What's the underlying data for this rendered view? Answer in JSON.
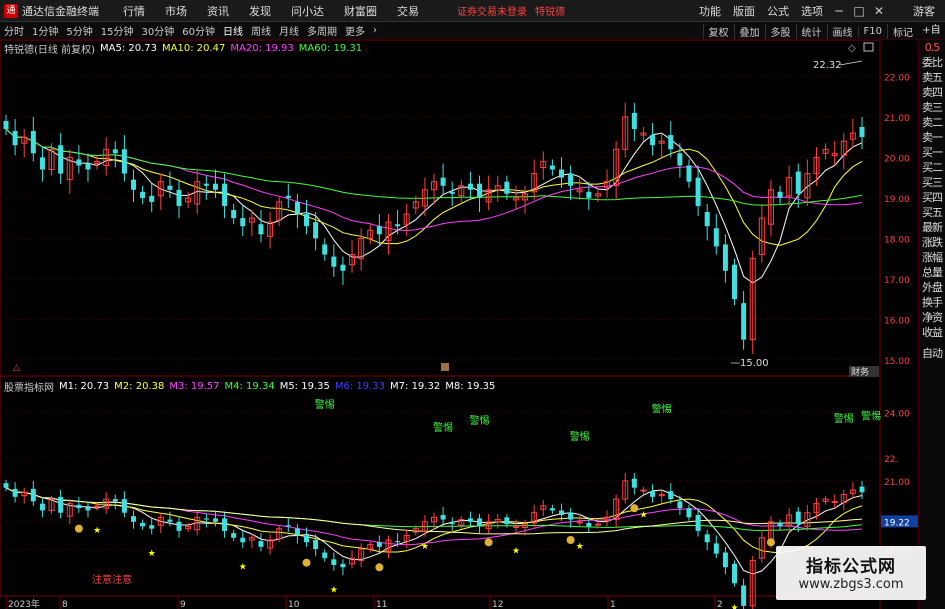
{
  "app": {
    "name": "通达信金融终端",
    "logo_text": "通",
    "menu": [
      "行情",
      "市场",
      "资讯",
      "发现",
      "问小达",
      "财富圈",
      "交易"
    ],
    "notice": "证券交易未登录",
    "stock_name": "特锐德",
    "tools": [
      "功能",
      "版面",
      "公式",
      "选项"
    ],
    "guest": "游客",
    "window_buttons": [
      "─",
      "□",
      "✕"
    ]
  },
  "toolbar": {
    "periods": [
      "分时",
      "1分钟",
      "5分钟",
      "15分钟",
      "30分钟",
      "60分钟",
      "日线",
      "周线",
      "月线",
      "多周期",
      "更多"
    ],
    "active_period": "日线",
    "more_arrow": "›",
    "buttons": [
      "复权",
      "叠加",
      "多股",
      "统计",
      "画线",
      "F10",
      "标记"
    ],
    "self_select": "+自选"
  },
  "main_legend": {
    "title": "特锐德(日线 前复权)",
    "items": [
      {
        "label": "MA5: 20.73",
        "color": "#ffffff"
      },
      {
        "label": "MA10: 20.47",
        "color": "#ffff40"
      },
      {
        "label": "MA20: 19.93",
        "color": "#ff40ff"
      },
      {
        "label": "MA60: 19.31",
        "color": "#40ff40"
      }
    ]
  },
  "sub_legend": {
    "title": "股票指标网",
    "items": [
      {
        "label": "M1: 20.73",
        "color": "#ffffff"
      },
      {
        "label": "M2: 20.38",
        "color": "#ffff40"
      },
      {
        "label": "M3: 19.57",
        "color": "#ff40ff"
      },
      {
        "label": "M4: 19.34",
        "color": "#40ff40"
      },
      {
        "label": "M5: 19.35",
        "color": "#ffffff"
      },
      {
        "label": "M6: 19.33",
        "color": "#4040ff"
      },
      {
        "label": "M7: 19.32",
        "color": "#ffffff"
      },
      {
        "label": "M8: 19.35",
        "color": "#ffffff"
      }
    ]
  },
  "sidebar": {
    "tabs": [
      "委比",
      "卖五",
      "卖四",
      "卖三",
      "卖二",
      "卖一",
      "买一",
      "买二",
      "买三",
      "买四",
      "买五",
      "最新",
      "涨跌",
      "涨幅",
      "总量",
      "外盘",
      "换手",
      "净资",
      "收益"
    ],
    "auto": "自动",
    "top_tab": "0.5"
  },
  "chart_data": {
    "type": "candlestick",
    "main_axis": {
      "ticks": [
        "22.00",
        "21.00",
        "20.00",
        "19.00",
        "18.00",
        "17.00",
        "16.00",
        "15.00"
      ],
      "ylim": [
        14.7,
        22.8
      ]
    },
    "sub_axis": {
      "ticks": [
        "24.00",
        "22.",
        "21.00",
        "19.22",
        "18.00"
      ],
      "ylim": [
        16.2,
        25
      ]
    },
    "annotations": {
      "high": "22.32",
      "low": "15.00",
      "finance_label": "财务"
    },
    "signal_label": "警惕",
    "bottom_signal": "注意注意",
    "x_labels": [
      "2023年",
      "8",
      "9",
      "10",
      "11",
      "12",
      "1",
      "2"
    ],
    "close_series": [
      20.7,
      20.3,
      20.5,
      20.1,
      19.7,
      20.2,
      19.6,
      20.0,
      19.8,
      19.7,
      19.9,
      20.2,
      20.1,
      19.6,
      19.2,
      19.0,
      18.9,
      19.4,
      19.2,
      18.8,
      19.0,
      19.4,
      19.3,
      19.2,
      18.8,
      18.5,
      18.3,
      18.5,
      18.1,
      18.4,
      18.9,
      19.0,
      18.6,
      18.3,
      18.0,
      17.6,
      17.3,
      17.2,
      17.6,
      18.0,
      18.2,
      18.1,
      18.4,
      18.3,
      18.6,
      18.9,
      19.2,
      19.4,
      19.3,
      19.1,
      19.3,
      19.2,
      19.0,
      19.2,
      19.3,
      19.1,
      19.0,
      19.1,
      19.6,
      19.9,
      19.7,
      19.5,
      19.3,
      19.2,
      19.0,
      19.1,
      19.4,
      20.2,
      21.0,
      20.7,
      20.6,
      20.3,
      20.4,
      20.2,
      19.8,
      19.4,
      18.8,
      18.3,
      17.8,
      17.2,
      16.5,
      15.5,
      17.5,
      18.5,
      19.2,
      19.0,
      19.5,
      19.1,
      19.6,
      20.0,
      20.2,
      20.1,
      20.4,
      20.6,
      20.5
    ]
  }
}
